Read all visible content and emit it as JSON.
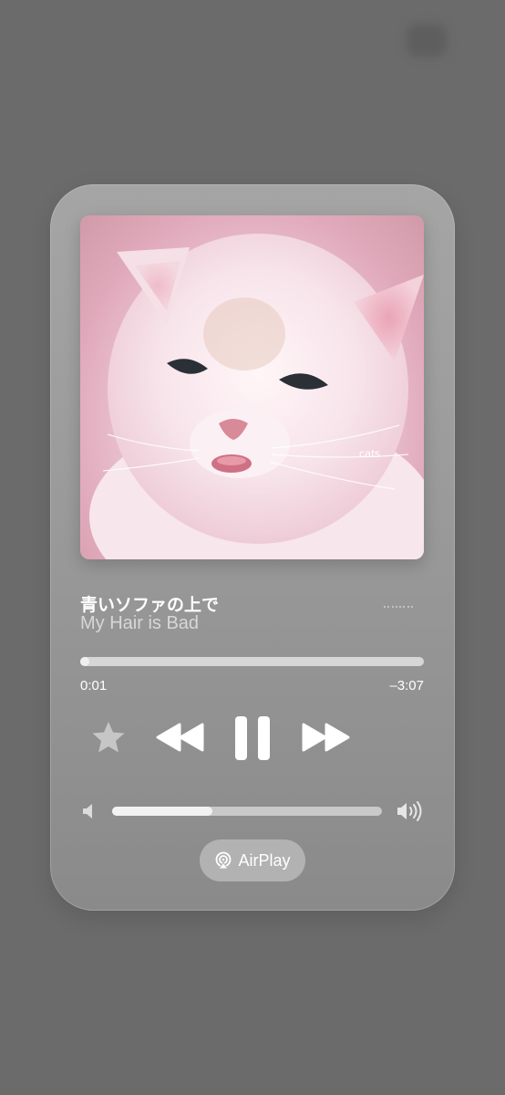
{
  "album_art": {
    "caption": "cats"
  },
  "track": {
    "title": "青いソファの上で",
    "artist": "My Hair is Bad"
  },
  "playback": {
    "elapsed": "0:01",
    "remaining": "–3:07",
    "progress_fraction": 0.005
  },
  "controls": {
    "favorite_icon": "star-icon",
    "previous_icon": "rewind-icon",
    "play_pause_icon": "pause-icon",
    "next_icon": "fast-forward-icon"
  },
  "volume": {
    "level_fraction": 0.37
  },
  "airplay": {
    "label": "AirPlay"
  },
  "colors": {
    "background": "#6b6b6b",
    "card": "#9a9a9a",
    "accent": "#ffffff"
  }
}
